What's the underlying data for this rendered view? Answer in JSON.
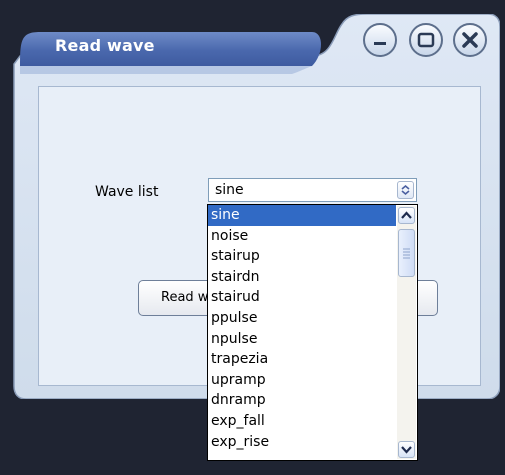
{
  "window": {
    "title": "Read wave",
    "controls": [
      "minimize-icon",
      "maximize-icon",
      "close-icon"
    ]
  },
  "form": {
    "wave_list_label": "Wave list",
    "selected_value": "sine",
    "read_button_label": "Read w"
  },
  "dropdown": {
    "items": [
      "sine",
      "noise",
      "stairup",
      "stairdn",
      "stairud",
      "ppulse",
      "npulse",
      "trapezia",
      "upramp",
      "dnramp",
      "exp_fall",
      "exp_rise"
    ],
    "selected_index": 0
  },
  "colors": {
    "title_bar": "#4f6fb2",
    "client_bg": "#e8eff8",
    "selection": "#316ac5",
    "desktop": "#1f2432"
  }
}
